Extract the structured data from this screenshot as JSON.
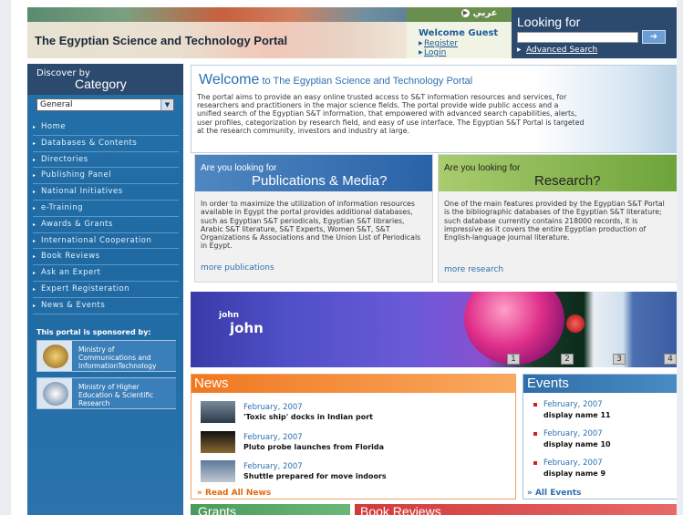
{
  "header": {
    "site_title": "The Egyptian Science and Technology Portal",
    "lang_switch": "عربي",
    "welcome": "Welcome Guest",
    "register": "Register",
    "login": "Login"
  },
  "search": {
    "title": "Looking for",
    "placeholder": "",
    "go": "➔",
    "advanced": "Advanced Search"
  },
  "sidebar": {
    "discover": "Discover by",
    "category": "Category",
    "selected": "General",
    "items": [
      {
        "label": "Home"
      },
      {
        "label": "Databases & Contents"
      },
      {
        "label": "Directories"
      },
      {
        "label": "Publishing Panel"
      },
      {
        "label": "National Initiatives"
      },
      {
        "label": "e-Training"
      },
      {
        "label": "Awards & Grants"
      },
      {
        "label": "International Cooperation"
      },
      {
        "label": "Book Reviews"
      },
      {
        "label": "Ask an Expert"
      },
      {
        "label": "Expert Registeration"
      },
      {
        "label": "News & Events"
      }
    ],
    "sponsor_heading": "This portal is sponsored by:",
    "sponsors": [
      {
        "line1": "Ministry of",
        "line2": "Communications and",
        "line3": "InformationTechnology"
      },
      {
        "line1": "Ministry of Higher",
        "line2": "Education & Scientific",
        "line3": "Research"
      }
    ]
  },
  "welcome": {
    "title_big": "Welcome",
    "title_rest": " to The Egyptian Science and Technology Portal",
    "body": "The portal aims to provide an easy online trusted access to S&T information resources and services, for researchers and practitioners in the major science fields. The portal provide wide public access and a unified search of the Egyptian S&T information, that empowered with advanced search capabilities, alerts, user profiles, categorization by research field, and easy of use interface. The Egyptian S&T Portal is targeted at the research community, investors and industry at large."
  },
  "publications": {
    "small": "Are you looking for",
    "large": "Publications & Media?",
    "body": "In order to maximize the utilization of information resources available in Egypt the portal provides additional databases, such as Egyptian S&T periodicals, Egyptian S&T libraries, Arabic S&T literature, S&T Experts, Women S&T, S&T Organizations & Associations and the Union List of Periodicals in Egypt.",
    "more": "more publications"
  },
  "research": {
    "small": "Are you looking for",
    "large": "Research?",
    "body": "One of the main features provided by the Egyptian S&T Portal is the bibliographic databases of the Egyptian S&T literature; such database currently contains 218000 records, it is impressive as it covers the entire Egyptian production of English-language journal literature.",
    "more": "more research"
  },
  "banner": {
    "small": "john",
    "big": "john",
    "pages": [
      "1",
      "2",
      "3",
      "4"
    ]
  },
  "news": {
    "title": "News",
    "items": [
      {
        "date": "February, 2007",
        "title": "'Toxic ship' docks in Indian port"
      },
      {
        "date": "February, 2007",
        "title": "Pluto probe launches from Florida"
      },
      {
        "date": "February, 2007",
        "title": "Shuttle prepared for move indoors"
      }
    ],
    "read_all": "Read All News"
  },
  "events": {
    "title": "Events",
    "items": [
      {
        "date": "February, 2007",
        "name": "display name 11"
      },
      {
        "date": "February, 2007",
        "name": "display name 10"
      },
      {
        "date": "February, 2007",
        "name": "display name 9"
      }
    ],
    "all": "All Events"
  },
  "bottom": {
    "grants": "Grants",
    "book_reviews": "Book Reviews"
  }
}
